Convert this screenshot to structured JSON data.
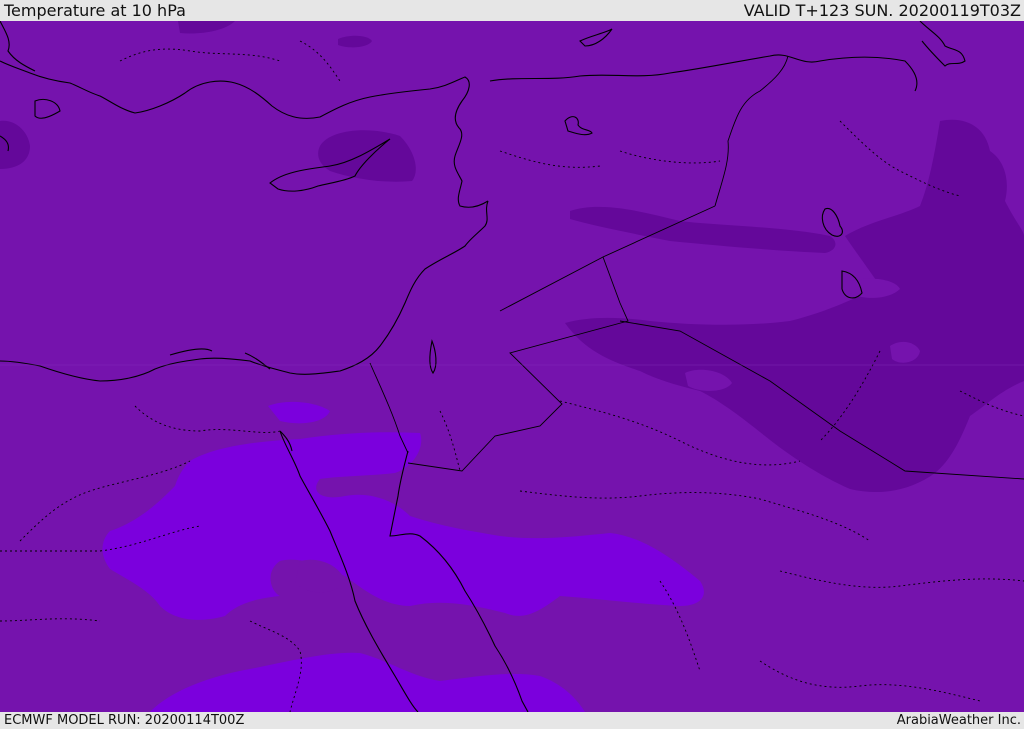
{
  "header": {
    "title": "Temperature at 10 hPa",
    "valid": "VALID T+123 SUN. 20200119T03Z"
  },
  "footer": {
    "model_run": "ECMWF MODEL RUN: 20200114T00Z",
    "credit": "ArabiaWeather Inc."
  },
  "colors": {
    "base": "#7513ad",
    "cold": "#64089a",
    "warm": "#7b00dd",
    "background": "#e6e6e6"
  }
}
